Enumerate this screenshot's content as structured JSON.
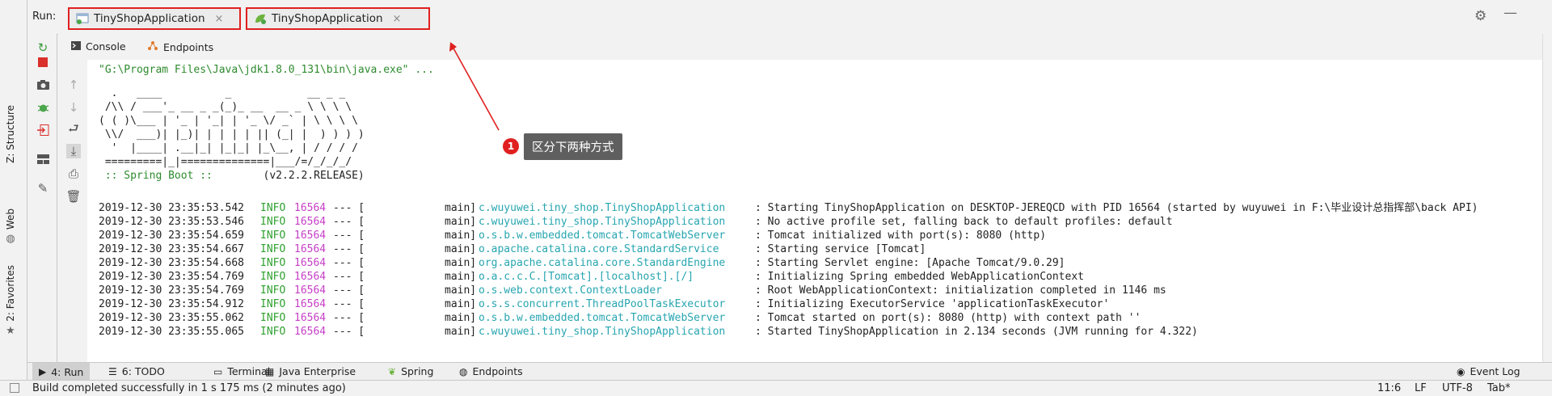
{
  "left_strip": {
    "structure_label": "Z: Structure",
    "web_label": "Web",
    "favorites_label": "2: Favorites"
  },
  "run": {
    "label": "Run:",
    "tabs": [
      {
        "label": "TinyShopApplication",
        "close": "×"
      },
      {
        "label": "TinyShopApplication",
        "close": "×"
      }
    ]
  },
  "subtabs": {
    "console": "Console",
    "endpoints": "Endpoints"
  },
  "console": {
    "command": "\"G:\\Program Files\\Java\\jdk1.8.0_131\\bin\\java.exe\" ...",
    "banner": [
      "  .   ____          _            __ _ _",
      " /\\\\ / ___'_ __ _ _(_)_ __  __ _ \\ \\ \\ \\",
      "( ( )\\___ | '_ | '_| | '_ \\/ _` | \\ \\ \\ \\",
      " \\\\/  ___)| |_)| | | | | || (_| |  ) ) ) )",
      "  '  |____| .__|_| |_|_| |_\\__, | / / / /",
      " =========|_|==============|___/=/_/_/_/"
    ],
    "spring_label": " :: Spring Boot ::",
    "spring_version": "(v2.2.2.RELEASE)",
    "logs": [
      {
        "ts": "2019-12-30 23:35:53.542",
        "level": "INFO",
        "pid": "16564",
        "sep": "--- [",
        "thread": "main]",
        "logger": "c.wuyuwei.tiny_shop.TinyShopApplication",
        "msg": ": Starting TinyShopApplication on DESKTOP-JEREQCD with PID 16564 (started by wuyuwei in F:\\毕业设计总指挥部\\back API)"
      },
      {
        "ts": "2019-12-30 23:35:53.546",
        "level": "INFO",
        "pid": "16564",
        "sep": "--- [",
        "thread": "main]",
        "logger": "c.wuyuwei.tiny_shop.TinyShopApplication",
        "msg": ": No active profile set, falling back to default profiles: default"
      },
      {
        "ts": "2019-12-30 23:35:54.659",
        "level": "INFO",
        "pid": "16564",
        "sep": "--- [",
        "thread": "main]",
        "logger": "o.s.b.w.embedded.tomcat.TomcatWebServer",
        "msg": ": Tomcat initialized with port(s): 8080 (http)"
      },
      {
        "ts": "2019-12-30 23:35:54.667",
        "level": "INFO",
        "pid": "16564",
        "sep": "--- [",
        "thread": "main]",
        "logger": "o.apache.catalina.core.StandardService",
        "msg": ": Starting service [Tomcat]"
      },
      {
        "ts": "2019-12-30 23:35:54.668",
        "level": "INFO",
        "pid": "16564",
        "sep": "--- [",
        "thread": "main]",
        "logger": "org.apache.catalina.core.StandardEngine",
        "msg": ": Starting Servlet engine: [Apache Tomcat/9.0.29]"
      },
      {
        "ts": "2019-12-30 23:35:54.769",
        "level": "INFO",
        "pid": "16564",
        "sep": "--- [",
        "thread": "main]",
        "logger": "o.a.c.c.C.[Tomcat].[localhost].[/]",
        "msg": ": Initializing Spring embedded WebApplicationContext"
      },
      {
        "ts": "2019-12-30 23:35:54.769",
        "level": "INFO",
        "pid": "16564",
        "sep": "--- [",
        "thread": "main]",
        "logger": "o.s.web.context.ContextLoader",
        "msg": ": Root WebApplicationContext: initialization completed in 1146 ms"
      },
      {
        "ts": "2019-12-30 23:35:54.912",
        "level": "INFO",
        "pid": "16564",
        "sep": "--- [",
        "thread": "main]",
        "logger": "o.s.s.concurrent.ThreadPoolTaskExecutor",
        "msg": ": Initializing ExecutorService 'applicationTaskExecutor'"
      },
      {
        "ts": "2019-12-30 23:35:55.062",
        "level": "INFO",
        "pid": "16564",
        "sep": "--- [",
        "thread": "main]",
        "logger": "o.s.b.w.embedded.tomcat.TomcatWebServer",
        "msg": ": Tomcat started on port(s): 8080 (http) with context path ''"
      },
      {
        "ts": "2019-12-30 23:35:55.065",
        "level": "INFO",
        "pid": "16564",
        "sep": "--- [",
        "thread": "main]",
        "logger": "c.wuyuwei.tiny_shop.TinyShopApplication",
        "msg": ": Started TinyShopApplication in 2.134 seconds (JVM running for 4.322)"
      }
    ]
  },
  "annotation": {
    "number": "1",
    "text": "区分下两种方式"
  },
  "bottom_tools": {
    "run": "4: Run",
    "todo": "6: TODO",
    "terminal": "Terminal",
    "java_enterprise": "Java Enterprise",
    "spring": "Spring",
    "endpoints": "Endpoints",
    "event_log": "Event Log"
  },
  "status": {
    "message": "Build completed successfully in 1 s 175 ms (2 minutes ago)",
    "position": "11:6",
    "line_sep": "LF",
    "encoding": "UTF-8",
    "indent": "Tab*"
  },
  "colors": {
    "accent_red": "#e02020",
    "info_green": "#2fa12f",
    "logger_cyan": "#27a5b0",
    "pid_magenta": "#c63ec6"
  }
}
